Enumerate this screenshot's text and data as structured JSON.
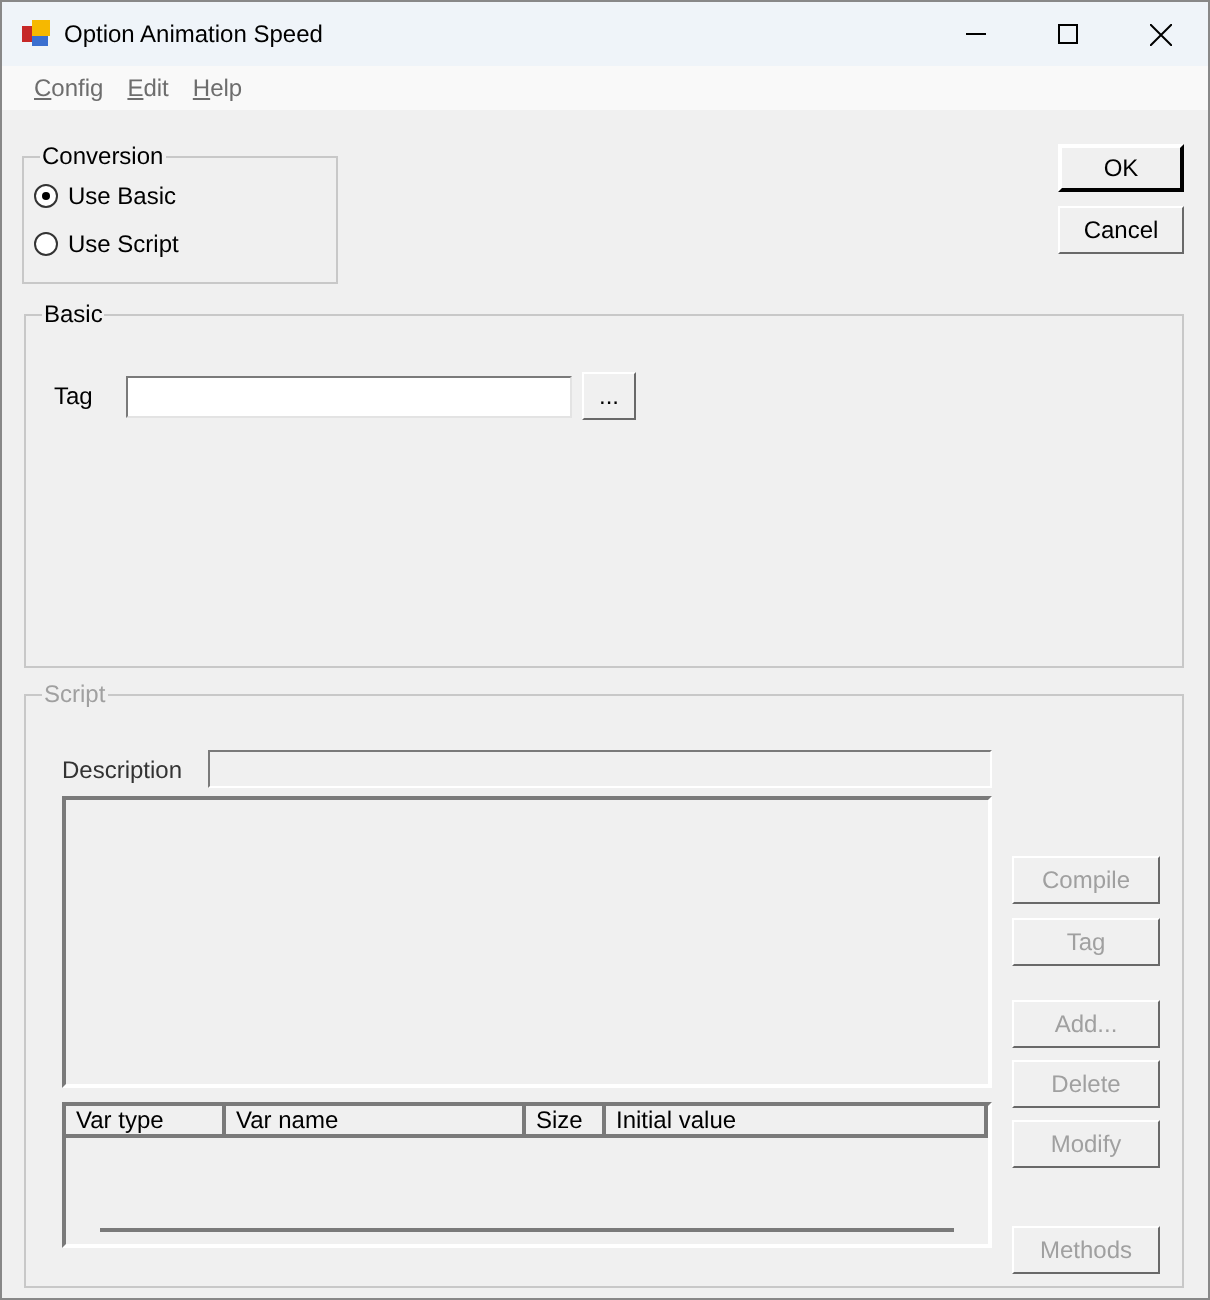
{
  "window": {
    "title": "Option Animation Speed"
  },
  "menu": [
    {
      "label": "Config",
      "disabled": true
    },
    {
      "label": "Edit",
      "disabled": true
    },
    {
      "label": "Help",
      "disabled": true
    }
  ],
  "conversion": {
    "title": "Conversion",
    "options": [
      {
        "label": "Use Basic",
        "selected": true
      },
      {
        "label": "Use Script",
        "selected": false
      }
    ]
  },
  "dialog_buttons": [
    {
      "label": "OK",
      "default": true
    },
    {
      "label": "Cancel",
      "default": false
    }
  ],
  "basic": {
    "title": "Basic",
    "tag_label": "Tag",
    "browse_button": "..."
  },
  "script": {
    "title": "Script",
    "disabled": true,
    "description_label": "Description",
    "columns": [
      "Var type",
      "Var name",
      "Size",
      "Initial value"
    ],
    "buttons": [
      {
        "label": "Compile",
        "disabled": true
      },
      {
        "label": "Tag",
        "disabled": true
      },
      {
        "label": "Add...",
        "disabled": true
      },
      {
        "label": "Delete",
        "disabled": true
      },
      {
        "label": "Modify",
        "disabled": true
      },
      {
        "label": "Methods",
        "disabled": true
      }
    ]
  }
}
